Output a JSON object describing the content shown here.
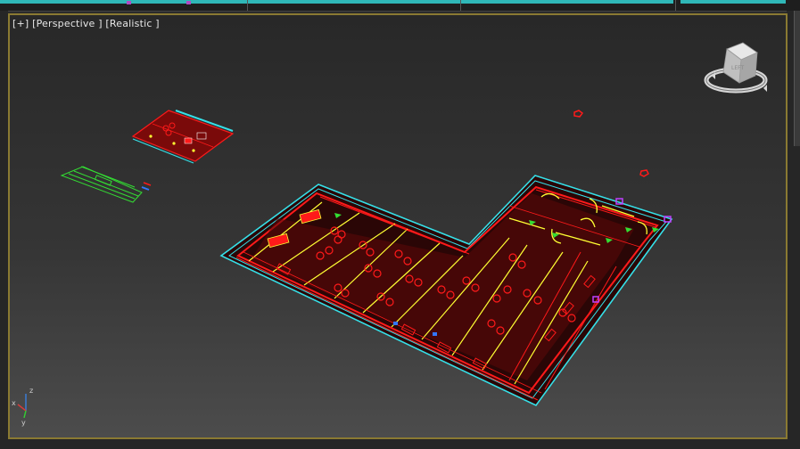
{
  "viewport": {
    "menu_plus": "[+]",
    "view_label": "[Perspective ]",
    "shading_label": "[Realistic ]"
  },
  "viewcube": {
    "face_label": "LEFT"
  },
  "axis_tripod": {
    "z": "z",
    "x": "x",
    "y": "y"
  },
  "colors": {
    "frame_border": "#8a7a32",
    "cad_red": "#ff1a1a",
    "cad_cyan": "#35e0e8",
    "cad_yellow": "#ffff33",
    "cad_green": "#33dd33",
    "cad_magenta": "#c040ff"
  }
}
